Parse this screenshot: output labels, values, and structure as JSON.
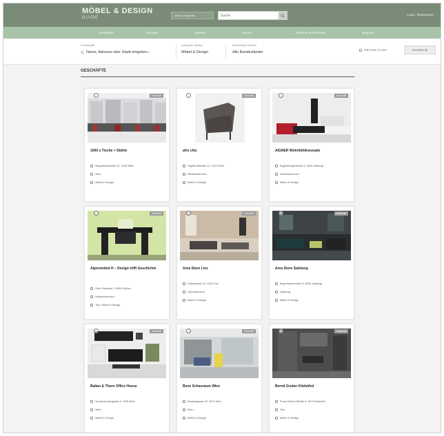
{
  "header": {
    "logo_main": "MÖBEL & DESIGN",
    "logo_sub": "GUIDE",
    "search_scope": "Mein Suchgebiet",
    "search_placeholder": "Suche",
    "login": "Login / Registrieren"
  },
  "nav": [
    "Geschäfte",
    "Designer",
    "Marken",
    "Events",
    "Wohnen & Einrichten",
    "Magazin"
  ],
  "filters": [
    {
      "label": "Suchbegriff",
      "value": "Name, Adresse oder Stadt eingeben..."
    },
    {
      "label": "Kategorie wählen",
      "value": "Möbel & Design"
    },
    {
      "label": "Bundesland wählen",
      "value": "Alle Bundesländer"
    }
  ],
  "more_filters": "WEITERE FILTER",
  "filter_search": "SUCHEN",
  "section_title": "GESCHÄFTE",
  "cards": [
    {
      "title": "1000 x Tische + Stühle",
      "badge": "Geschäft",
      "lines": [
        "Margaretenstraße 10, 1040 Wien",
        "Wien",
        "Möbel & Design"
      ]
    },
    {
      "title": "afro chic",
      "badge": "Geschäft",
      "lines": [
        "Tegetthoffstraße 14, 1010 Wien",
        "Niederösterreich",
        "Möbel & Design"
      ]
    },
    {
      "title": "AIGNER Wohnfühlkonzepte",
      "badge": "Geschäft",
      "lines": [
        "Eggelsbergerstraße 5, 5020 Salzburg",
        "Niederösterreich",
        "Möbel & Design"
      ]
    },
    {
      "title": "Alpenmöbel H – Design trifft Geschichte",
      "badge": "Geschäft",
      "lines": [
        "Ortho Hallweg 1, 5645 Großarl",
        "Niederösterreich",
        "Tirol, Möbel & Design"
      ]
    },
    {
      "title": "Area Store Linz",
      "badge": "Geschäft",
      "lines": [
        "Hafenstraße 10, 4020 Linz",
        "Oberösterreich",
        "Möbel & Design"
      ]
    },
    {
      "title": "Area Store Salzburg",
      "badge": "Geschäft",
      "lines": [
        "Bayerhamerstraße 8, 5020 Salzburg",
        "Salzburg",
        "Möbel & Design"
      ]
    },
    {
      "title": "Balian & Thurn Office House",
      "badge": "Geschäft",
      "lines": [
        "Schwarzenbergplatz 5, 1030 Wien",
        "Wien",
        "Möbel & Design"
      ]
    },
    {
      "title": "Bene Schauraum Wien",
      "badge": "Geschäft",
      "lines": [
        "Neubaugasse 18, 1070 Wien",
        "Wien",
        "Möbel & Design"
      ]
    },
    {
      "title": "Bernd Gruber Kitzbühel",
      "badge": "Geschäft",
      "lines": [
        "Franz-Reisch-Straße 8, 6370 Kitzbühel",
        "Tirol",
        "Möbel & Design"
      ]
    }
  ],
  "colors": {
    "topbar": "#7a8c78",
    "navbar": "#a8c3a8",
    "background": "#f3f3f3"
  }
}
